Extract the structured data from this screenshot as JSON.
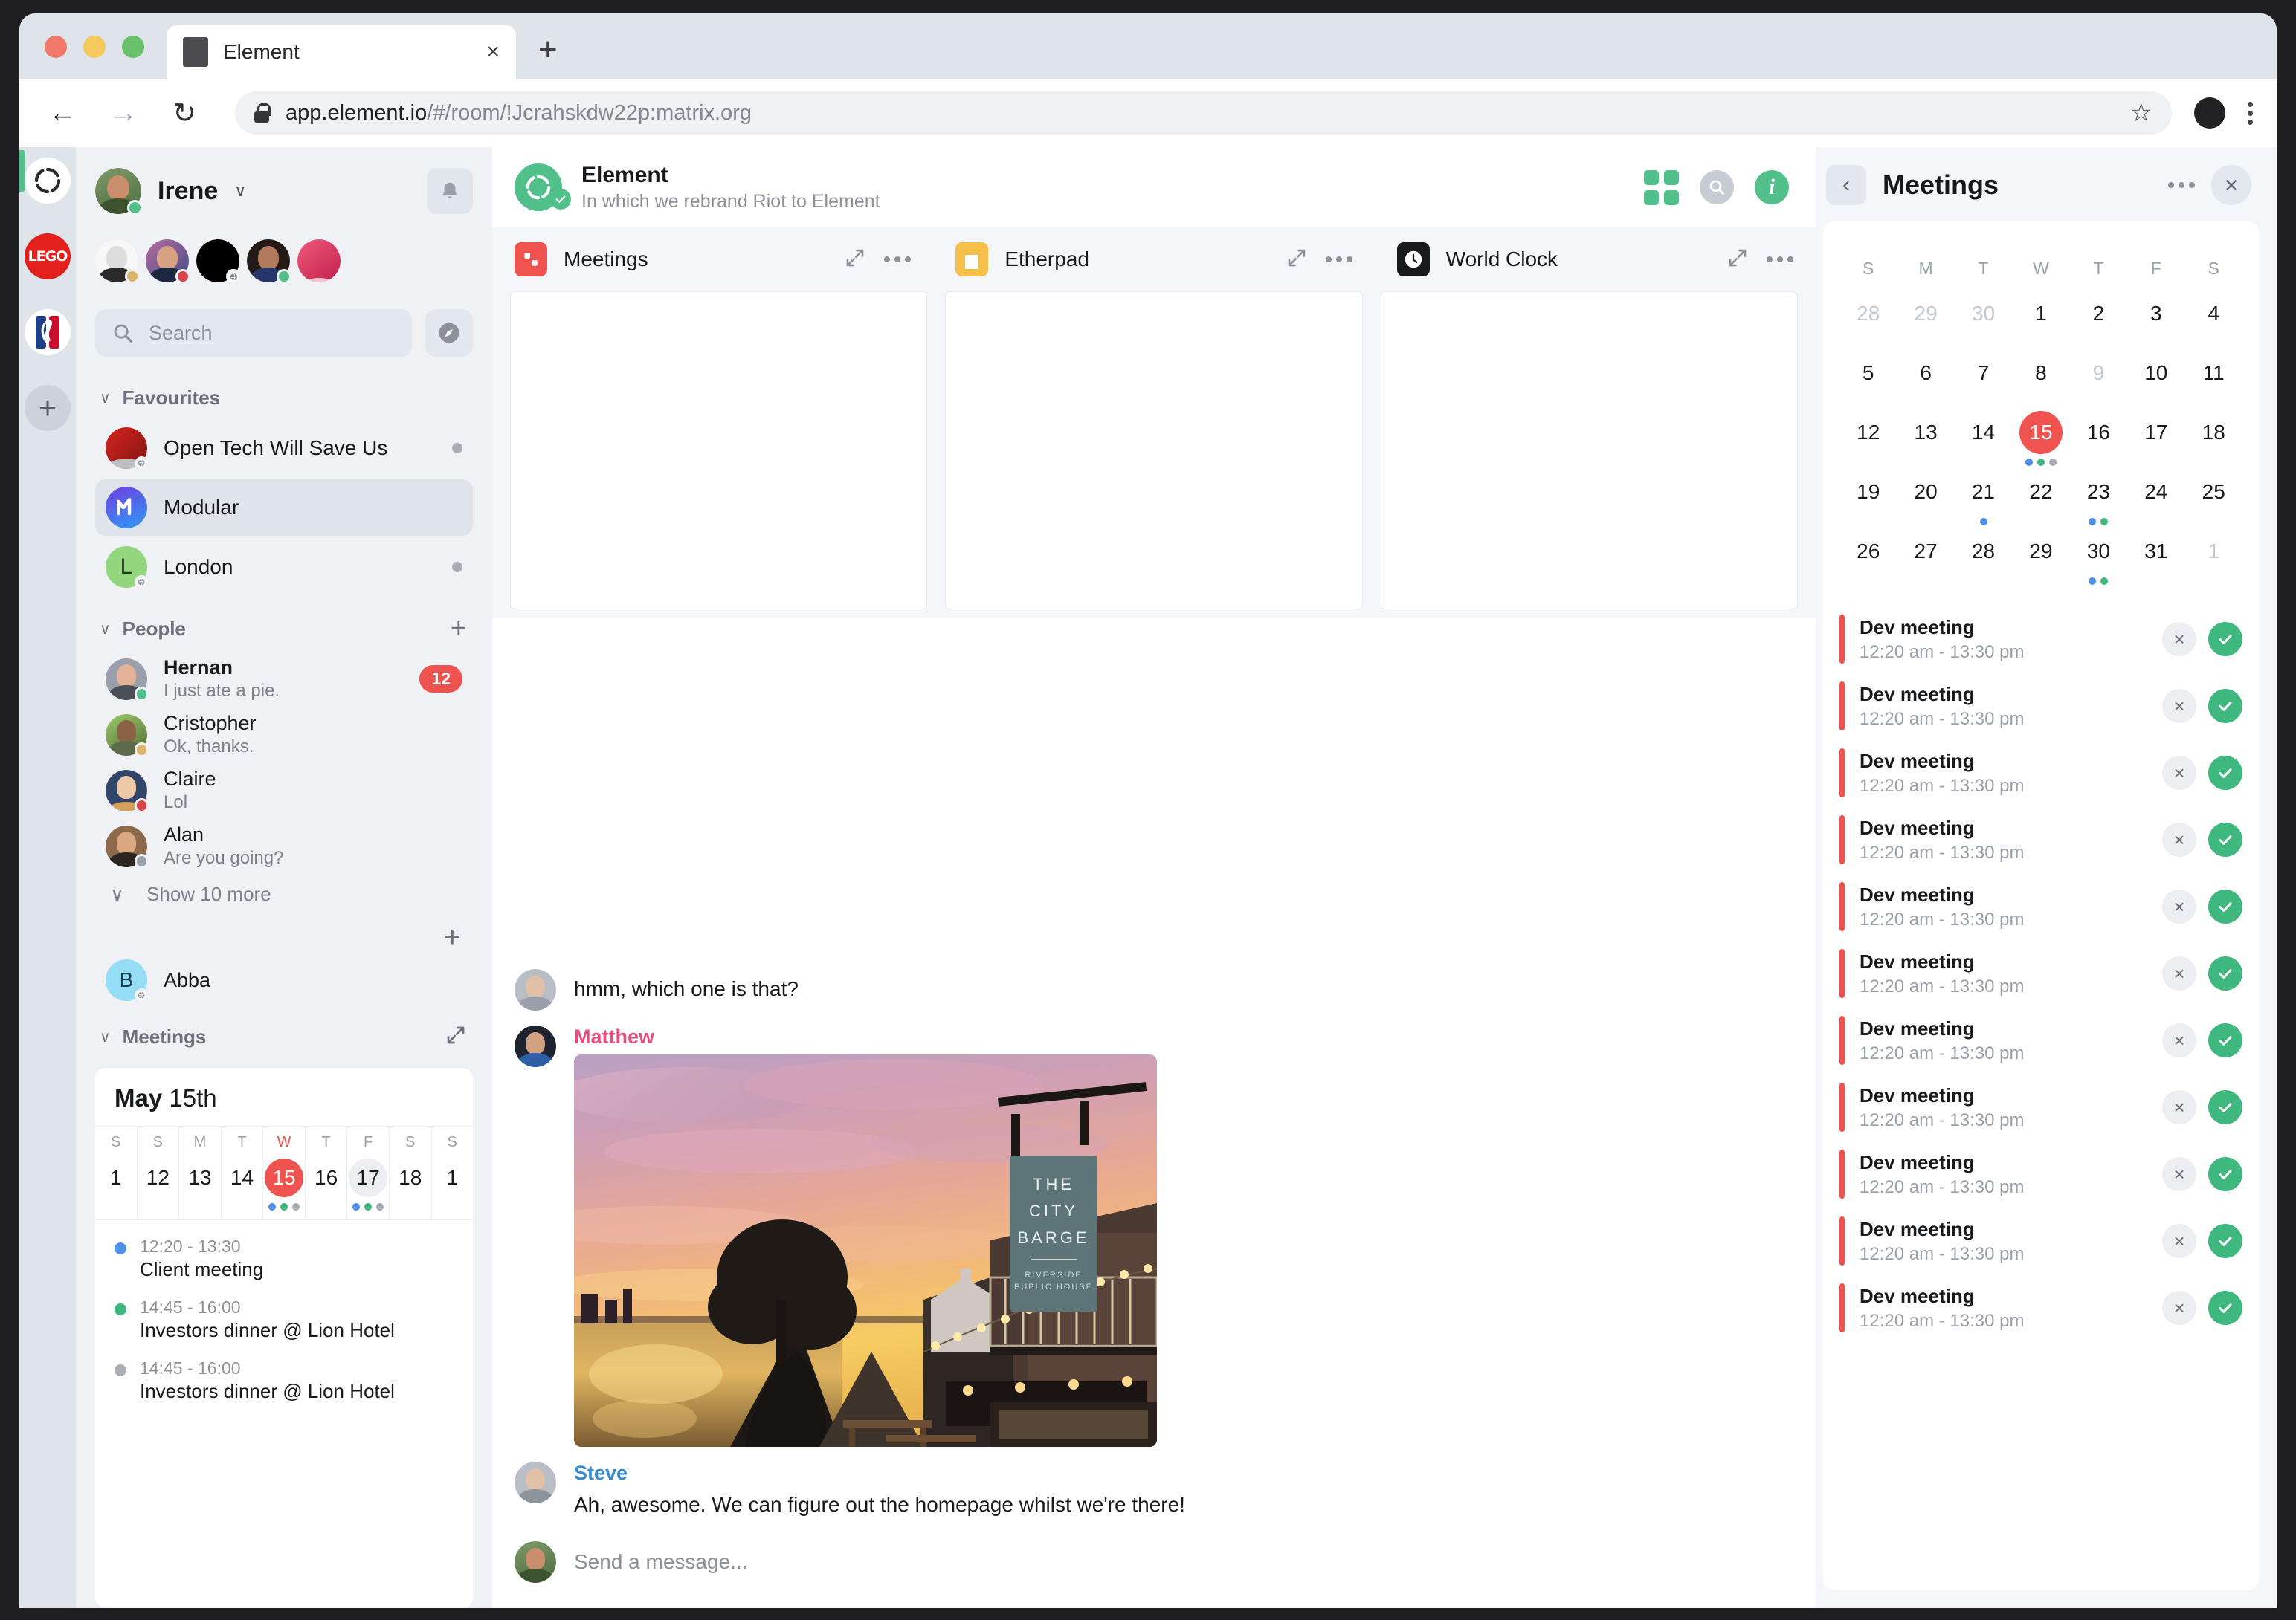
{
  "browser": {
    "tab_title": "Element",
    "tab_close": "×",
    "new_tab": "+",
    "back": "←",
    "forward": "→",
    "reload": "↻",
    "url_main": "app.element.io",
    "url_path": "/#/room/!Jcrahskdw22p:matrix.org",
    "bookmark": "☆"
  },
  "rail": {
    "items": [
      {
        "name": "element-home",
        "label": ""
      },
      {
        "name": "lego-space",
        "label": "LEGO"
      },
      {
        "name": "nba-space",
        "label": "NBA"
      },
      {
        "name": "add-space",
        "label": "+"
      }
    ]
  },
  "sidebar": {
    "user": {
      "name": "Irene",
      "presence": "online",
      "chevron": "∨"
    },
    "search": {
      "placeholder": "Search"
    },
    "sections": [
      {
        "title": "Favourites",
        "chevron": "∨"
      },
      {
        "title": "People",
        "chevron": "∨",
        "add": "+"
      },
      {
        "title": "Meetings",
        "chevron": "∨"
      }
    ],
    "rooms": [
      {
        "name": "Open Tech Will Save Us",
        "active": false,
        "unread_dot": true
      },
      {
        "name": "Modular",
        "active": true,
        "unread_dot": false
      },
      {
        "name": "London",
        "active": false,
        "unread_dot": true
      }
    ],
    "people": [
      {
        "name": "Hernan",
        "preview": "I just ate a pie.",
        "badge": "12",
        "presence": "online",
        "bold": true
      },
      {
        "name": "Cristopher",
        "preview": "Ok, thanks.",
        "badge": "",
        "presence": "away",
        "bold": false
      },
      {
        "name": "Claire",
        "preview": "Lol",
        "badge": "",
        "presence": "busy",
        "bold": false
      },
      {
        "name": "Alan",
        "preview": "Are you going?",
        "badge": "",
        "presence": "offline",
        "bold": false
      }
    ],
    "show_more": "Show 10 more",
    "abba": {
      "name": "Abba",
      "initial": "B"
    },
    "add_room": "+",
    "mini_widget": {
      "month": "May",
      "day": "15th",
      "dows": [
        "S",
        "S",
        "M",
        "T",
        "W",
        "T",
        "F",
        "S",
        "S"
      ],
      "days": [
        "1",
        "12",
        "13",
        "14",
        "15",
        "16",
        "17",
        "18",
        "1"
      ],
      "today_index": 4,
      "hover_index": 6,
      "dot_rows": {
        "4": [
          "#4e8fe8",
          "#3fb87f",
          "#a8adb6"
        ],
        "6": [
          "#4e8fe8",
          "#3fb87f",
          "#a8adb6"
        ]
      },
      "events": [
        {
          "time": "12:20 - 13:30",
          "title": "Client meeting",
          "color": "#4e8fe8"
        },
        {
          "time": "14:45 - 16:00",
          "title": "Investors dinner @ Lion Hotel",
          "color": "#3fb87f"
        },
        {
          "time": "14:45 - 16:00",
          "title": "Investors dinner @ Lion Hotel",
          "color": "#a8adb6"
        }
      ]
    }
  },
  "room_header": {
    "title": "Element",
    "topic": "In which we rebrand Riot to Element"
  },
  "widgets": [
    {
      "name": "Meetings",
      "icon_color": "#ef5350"
    },
    {
      "name": "Etherpad",
      "icon_color": "#f5c04a"
    },
    {
      "name": "World Clock",
      "icon_color": "#17191c"
    }
  ],
  "timeline": {
    "messages": [
      {
        "sender": "",
        "sender_class": "steve",
        "text": "hmm, which one is that?",
        "type": "text"
      },
      {
        "sender": "Matthew",
        "sender_class": "matthew",
        "text": "",
        "type": "image",
        "image_alt": "THE CITY BARGE riverside pub at sunset"
      },
      {
        "sender": "Steve",
        "sender_class": "steve",
        "text": "Ah, awesome. We can figure out the homepage whilst we're there!",
        "type": "text"
      }
    ],
    "composer_placeholder": "Send a message..."
  },
  "right_panel": {
    "title": "Meetings",
    "back": "‹",
    "close": "×",
    "calendar": {
      "dows": [
        "S",
        "M",
        "T",
        "W",
        "T",
        "F",
        "S"
      ],
      "weeks": [
        [
          {
            "d": "28",
            "muted": true
          },
          {
            "d": "29",
            "muted": true
          },
          {
            "d": "30",
            "muted": true
          },
          {
            "d": "1"
          },
          {
            "d": "2"
          },
          {
            "d": "3"
          },
          {
            "d": "4"
          }
        ],
        [
          {
            "d": "5"
          },
          {
            "d": "6"
          },
          {
            "d": "7"
          },
          {
            "d": "8"
          },
          {
            "d": "9",
            "muted": true
          },
          {
            "d": "10"
          },
          {
            "d": "11"
          }
        ],
        [
          {
            "d": "12"
          },
          {
            "d": "13"
          },
          {
            "d": "14"
          },
          {
            "d": "15",
            "today": true,
            "dots": [
              "#4e8fe8",
              "#3fb87f",
              "#a8adb6"
            ]
          },
          {
            "d": "16"
          },
          {
            "d": "17"
          },
          {
            "d": "18"
          }
        ],
        [
          {
            "d": "19"
          },
          {
            "d": "20"
          },
          {
            "d": "21",
            "dots": [
              "#4e8fe8"
            ]
          },
          {
            "d": "22"
          },
          {
            "d": "23",
            "dots": [
              "#4e8fe8",
              "#3fb87f"
            ]
          },
          {
            "d": "24"
          },
          {
            "d": "25"
          }
        ],
        [
          {
            "d": "26"
          },
          {
            "d": "27"
          },
          {
            "d": "28"
          },
          {
            "d": "29"
          },
          {
            "d": "30",
            "dots": [
              "#4e8fe8",
              "#3fb87f"
            ]
          },
          {
            "d": "31"
          },
          {
            "d": "1",
            "muted": true
          }
        ]
      ]
    },
    "meetings": [
      {
        "title": "Dev meeting",
        "time": "12:20 am - 13:30 pm"
      },
      {
        "title": "Dev meeting",
        "time": "12:20 am - 13:30 pm"
      },
      {
        "title": "Dev meeting",
        "time": "12:20 am - 13:30 pm"
      },
      {
        "title": "Dev meeting",
        "time": "12:20 am - 13:30 pm"
      },
      {
        "title": "Dev meeting",
        "time": "12:20 am - 13:30 pm"
      },
      {
        "title": "Dev meeting",
        "time": "12:20 am - 13:30 pm"
      },
      {
        "title": "Dev meeting",
        "time": "12:20 am - 13:30 pm"
      },
      {
        "title": "Dev meeting",
        "time": "12:20 am - 13:30 pm"
      },
      {
        "title": "Dev meeting",
        "time": "12:20 am - 13:30 pm"
      },
      {
        "title": "Dev meeting",
        "time": "12:20 am - 13:30 pm"
      },
      {
        "title": "Dev meeting",
        "time": "12:20 am - 13:30 pm"
      }
    ],
    "reject_label": "×",
    "accept_label": "✓"
  },
  "colors": {
    "accent_green": "#52c08a",
    "accent_red": "#ef5350",
    "link_blue": "#368bd6",
    "pink": "#e64f7a"
  }
}
